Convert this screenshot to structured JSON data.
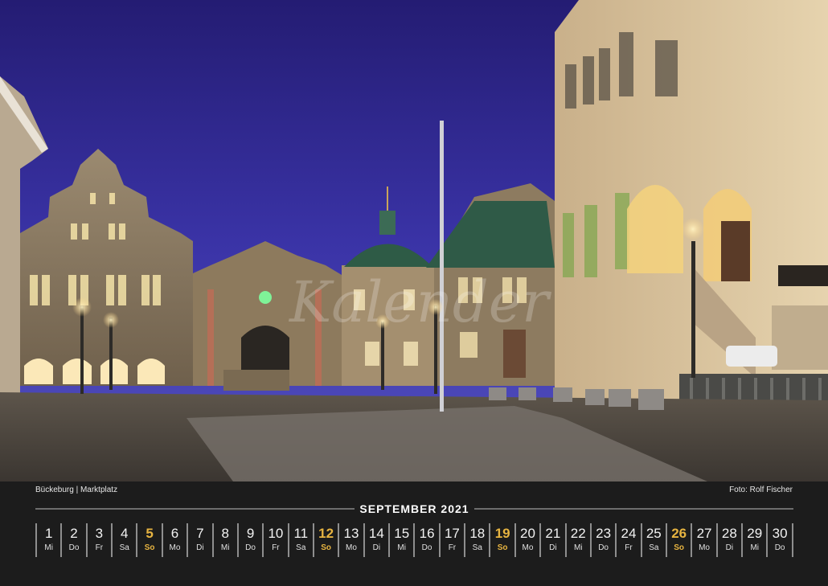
{
  "photo": {
    "watermark": "Kalender"
  },
  "caption": {
    "location": "Bückeburg | Marktplatz",
    "credit": "Foto: Rolf Fischer"
  },
  "calendar": {
    "month_title": "SEPTEMBER 2021",
    "accent_color": "#e7b441",
    "days": [
      {
        "num": "1",
        "wd": "Mi",
        "sunday": false
      },
      {
        "num": "2",
        "wd": "Do",
        "sunday": false
      },
      {
        "num": "3",
        "wd": "Fr",
        "sunday": false
      },
      {
        "num": "4",
        "wd": "Sa",
        "sunday": false
      },
      {
        "num": "5",
        "wd": "So",
        "sunday": true
      },
      {
        "num": "6",
        "wd": "Mo",
        "sunday": false
      },
      {
        "num": "7",
        "wd": "Di",
        "sunday": false
      },
      {
        "num": "8",
        "wd": "Mi",
        "sunday": false
      },
      {
        "num": "9",
        "wd": "Do",
        "sunday": false
      },
      {
        "num": "10",
        "wd": "Fr",
        "sunday": false
      },
      {
        "num": "11",
        "wd": "Sa",
        "sunday": false
      },
      {
        "num": "12",
        "wd": "So",
        "sunday": true
      },
      {
        "num": "13",
        "wd": "Mo",
        "sunday": false
      },
      {
        "num": "14",
        "wd": "Di",
        "sunday": false
      },
      {
        "num": "15",
        "wd": "Mi",
        "sunday": false
      },
      {
        "num": "16",
        "wd": "Do",
        "sunday": false
      },
      {
        "num": "17",
        "wd": "Fr",
        "sunday": false
      },
      {
        "num": "18",
        "wd": "Sa",
        "sunday": false
      },
      {
        "num": "19",
        "wd": "So",
        "sunday": true
      },
      {
        "num": "20",
        "wd": "Mo",
        "sunday": false
      },
      {
        "num": "21",
        "wd": "Di",
        "sunday": false
      },
      {
        "num": "22",
        "wd": "Mi",
        "sunday": false
      },
      {
        "num": "23",
        "wd": "Do",
        "sunday": false
      },
      {
        "num": "24",
        "wd": "Fr",
        "sunday": false
      },
      {
        "num": "25",
        "wd": "Sa",
        "sunday": false
      },
      {
        "num": "26",
        "wd": "So",
        "sunday": true
      },
      {
        "num": "27",
        "wd": "Mo",
        "sunday": false
      },
      {
        "num": "28",
        "wd": "Di",
        "sunday": false
      },
      {
        "num": "29",
        "wd": "Mi",
        "sunday": false
      },
      {
        "num": "30",
        "wd": "Do",
        "sunday": false
      }
    ]
  }
}
